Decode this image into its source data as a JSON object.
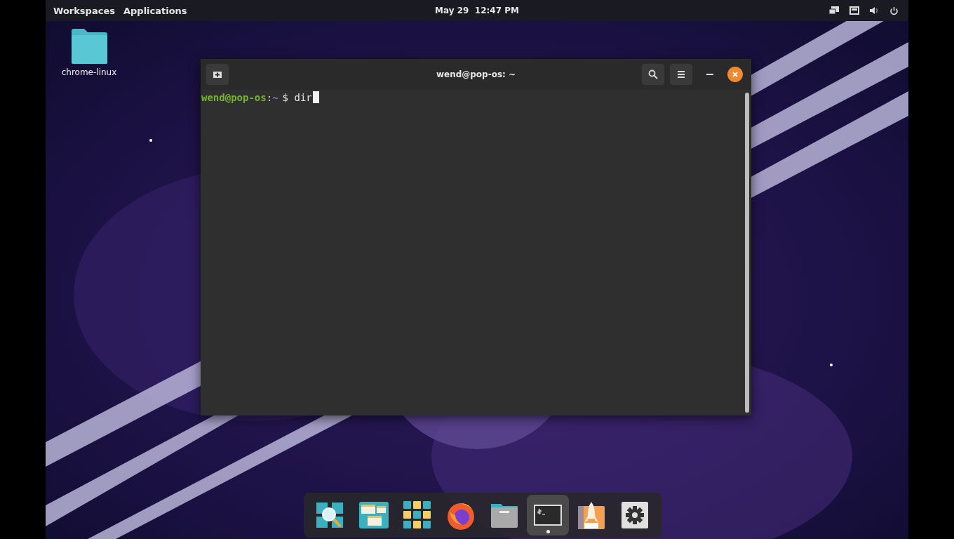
{
  "top_bar": {
    "menus": [
      {
        "label": "Workspaces"
      },
      {
        "label": "Applications"
      }
    ],
    "clock": "May 29  12:47 PM"
  },
  "desktop_icons": [
    {
      "label": "chrome-linux"
    }
  ],
  "terminal": {
    "title": "wend@pop-os: ~",
    "user_host": "wend@pop-os",
    "separator": ":",
    "path": "~",
    "symbol": "$",
    "command": "dir"
  },
  "dock": [
    {
      "kind": "search",
      "selected": false
    },
    {
      "kind": "workspaces",
      "selected": false
    },
    {
      "kind": "apps",
      "selected": false
    },
    {
      "kind": "browser",
      "selected": false
    },
    {
      "kind": "files",
      "selected": false
    },
    {
      "kind": "terminal",
      "selected": true
    },
    {
      "kind": "shop",
      "selected": false
    },
    {
      "kind": "settings",
      "selected": false
    }
  ]
}
